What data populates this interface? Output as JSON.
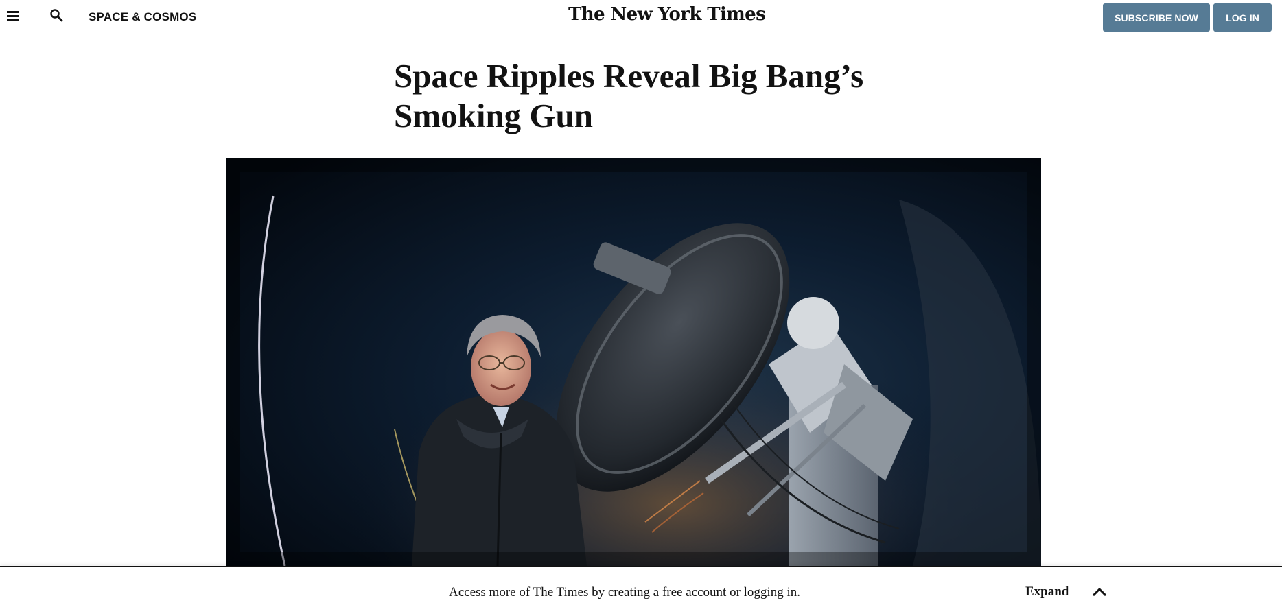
{
  "header": {
    "menu_icon": "hamburger-menu-icon",
    "search_icon": "search-icon",
    "section_label": "SPACE & COSMOS",
    "logo_text": "The New York Times",
    "subscribe_label": "SUBSCRIBE NOW",
    "login_label": "LOG IN",
    "button_color": "#567b95"
  },
  "article": {
    "headline": "Space Ripples Reveal Big Bang’s Smoking Gun",
    "image_alt": "A smiling scientist in a dark parka stands beside a large telescope at dusk"
  },
  "gateway": {
    "message": "Access more of The Times by creating a free account or logging in.",
    "expand_label": "Expand",
    "expand_icon": "chevron-up-icon"
  }
}
